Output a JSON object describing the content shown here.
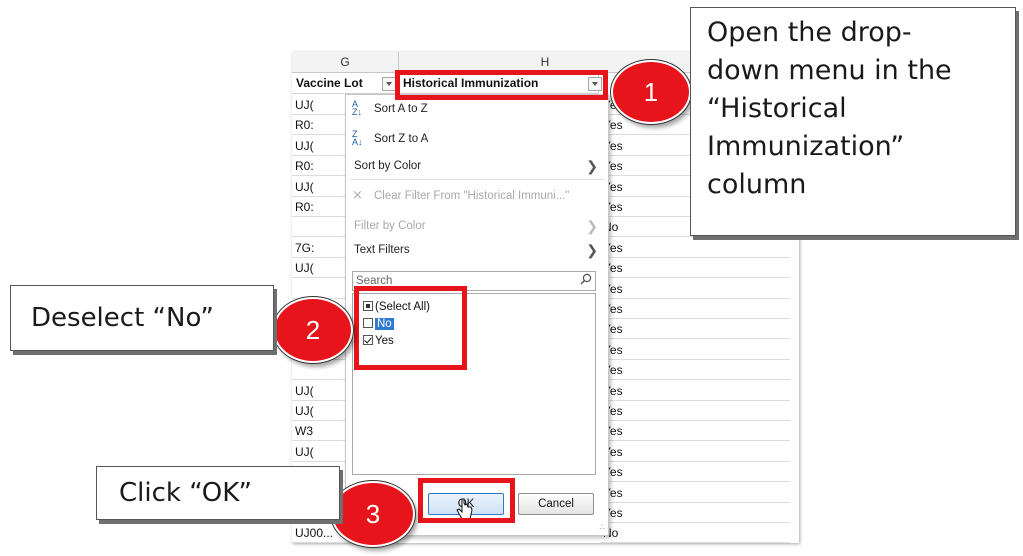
{
  "sheet": {
    "col_g": "G",
    "col_h": "H",
    "header_g": "Vaccine Lot",
    "header_h": "Historical Immunization",
    "col_g_rows": [
      "UJ(",
      "R0:",
      "UJ(",
      "R0:",
      "UJ(",
      "R0:",
      "",
      "7G:",
      "UJ(",
      "",
      "",
      "",
      "",
      "",
      "UJ(",
      "UJ(",
      "W3",
      "UJ(",
      "W3",
      "",
      "",
      "UJ00..."
    ],
    "col_h_rows": [
      "Yes",
      "Yes",
      "Yes",
      "Yes",
      "Yes",
      "Yes",
      "No",
      "Yes",
      "Yes",
      "Yes",
      "Yes",
      "Yes",
      "Yes",
      "Yes",
      "Yes",
      "Yes",
      "Yes",
      "Yes",
      "Yes",
      "Yes",
      "Yes",
      "No"
    ]
  },
  "filter_menu": {
    "sort_az": "Sort A to Z",
    "sort_za": "Sort Z to A",
    "sort_by_color": "Sort by Color",
    "clear_filter": "Clear Filter From \"Historical Immuni...\"",
    "filter_by_color": "Filter by Color",
    "text_filters": "Text Filters",
    "search_placeholder": "Search",
    "items": {
      "select_all": "(Select All)",
      "no": "No",
      "yes": "Yes"
    },
    "ok": "OK",
    "cancel": "Cancel"
  },
  "annotations": {
    "step1_number": "1",
    "step1_lines": [
      "Open the drop-",
      "down menu in the",
      "“Historical",
      "Immunization”",
      "column"
    ],
    "step2_number": "2",
    "step2_text": "Deselect “No”",
    "step3_number": "3",
    "step3_text": "Click “OK”",
    "accent_color": "#e8141b"
  }
}
